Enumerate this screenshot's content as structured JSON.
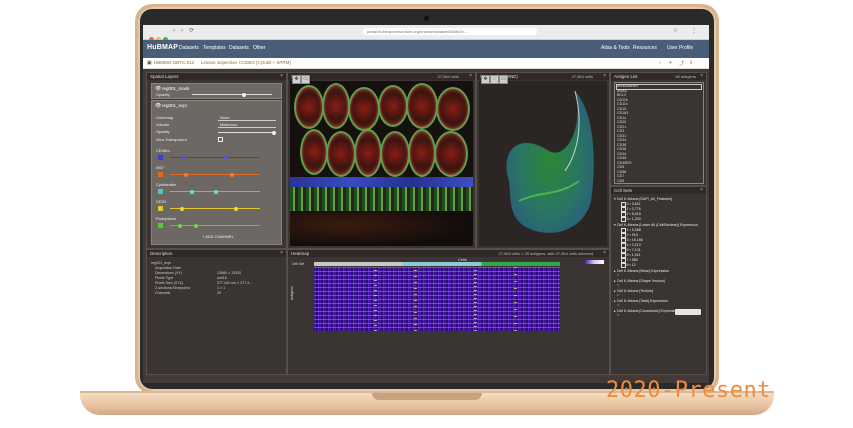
{
  "overlay_text": "2020-Present",
  "colors": {
    "accent": "#f08a3c",
    "nav_bg": "#4b5e79",
    "laptop": "#e7c8a6"
  },
  "browser": {
    "url": "portal.hubmapconsortium.org/browse/dataset/83c8e2b...",
    "buttons": [
      "‹",
      "›",
      "⟳",
      "☆",
      "⋮"
    ]
  },
  "nav": {
    "logo": "HuBMAP",
    "items": [
      "Datasets",
      "Templates",
      "Datasets",
      "Other"
    ],
    "right_items": [
      "Atlas & Tools",
      "Resources",
      "User Profile"
    ]
  },
  "breadcrumb": {
    "id": "HBM694.GBTC.612",
    "items": [
      "Lesson inspection",
      "CODEX [Cytokit + SPRM]"
    ]
  },
  "spatial_layers": {
    "title": "Spatial Layers",
    "layer1": {
      "name": "reg001_mask",
      "opacity_label": "Opacity"
    },
    "layer2": {
      "name": "reg001_expr",
      "rows": [
        {
          "label": "Colormap",
          "value": "None"
        },
        {
          "label": "Volume",
          "value": "Maximum"
        },
        {
          "label": "Opacity",
          "value": ""
        },
        {
          "label": "Zero Transparent",
          "value": ""
        }
      ],
      "channels": [
        {
          "name": "CD45ro",
          "color": "#3d3dd6"
        },
        {
          "name": "Ki67",
          "color": "#e06a1e"
        },
        {
          "name": "Cytokeratin",
          "color": "#49c9b8"
        },
        {
          "name": "CD31",
          "color": "#e0c72a"
        },
        {
          "name": "Podoplanin",
          "color": "#55cc33"
        }
      ],
      "add_channel": "+ ADD CHANNEL"
    }
  },
  "spatial": {
    "title": "Spatial",
    "info": "27,564 cells"
  },
  "scatter": {
    "title": "Scatterplot (t-SNE)",
    "info": "27,564 cells"
  },
  "antigen": {
    "title": "Antigen List",
    "info": "48 antigens",
    "items": [
      "aSMAblaned",
      "aSMA",
      "BCL2",
      "CD11b",
      "CD11c",
      "CD15",
      "CD163",
      "CD1c",
      "CD20",
      "CD21",
      "CD3",
      "CD31",
      "CD34",
      "CD36",
      "CD38",
      "CD44",
      "CD45",
      "CD45RO",
      "CD5",
      "CD68",
      "CD7",
      "CD8"
    ]
  },
  "cell_sets": {
    "title": "Cell Sets",
    "groups": [
      {
        "label": "Cell K-Means [DAPI_All_Features]",
        "children": [
          "0",
          "1",
          "2",
          "3"
        ]
      },
      {
        "label": "Cell K-Means [Lower All (Cell/Nuclear)] Expression",
        "children": [
          "1",
          "2",
          "3",
          "4",
          "5",
          "6",
          "7",
          "8"
        ]
      },
      {
        "label": "Cell K-Means [Mean] Expression"
      },
      {
        "label": "Cell K-Means [Shape Vectors]"
      },
      {
        "label": "Cell K-Means [Texture]"
      },
      {
        "label": "Cell K-Means [Total] Expression"
      },
      {
        "label": "Cell K-Means [Covariance] Expression"
      }
    ],
    "counts": [
      "3,611",
      "2,776",
      "6,018",
      "1,203",
      "5,388",
      "910",
      "16,166",
      "2,213",
      "7,131",
      "1,011",
      "580",
      "12"
    ]
  },
  "description": {
    "title": "Description",
    "subtitle": "reg001_expr",
    "rows": [
      {
        "k": "Acquisition Date",
        "v": ""
      },
      {
        "k": "Dimensions (XY)",
        "v": "13680 × 13530"
      },
      {
        "k": "Pixels Type",
        "v": "uint16"
      },
      {
        "k": "Pixels Size (XYZ)",
        "v": "377.442 nm × 377.4..."
      },
      {
        "k": "Z-sections/Timepoints",
        "v": "1 × 1"
      },
      {
        "k": "Channels",
        "v": "29"
      }
    ]
  },
  "heatmap": {
    "title": "Heatmap",
    "info": "27,564 cells × 29 antigens, with 27,564 cells selected",
    "x_label": "Cells",
    "y_label": "Antigens",
    "row_label": "Cell Set"
  }
}
